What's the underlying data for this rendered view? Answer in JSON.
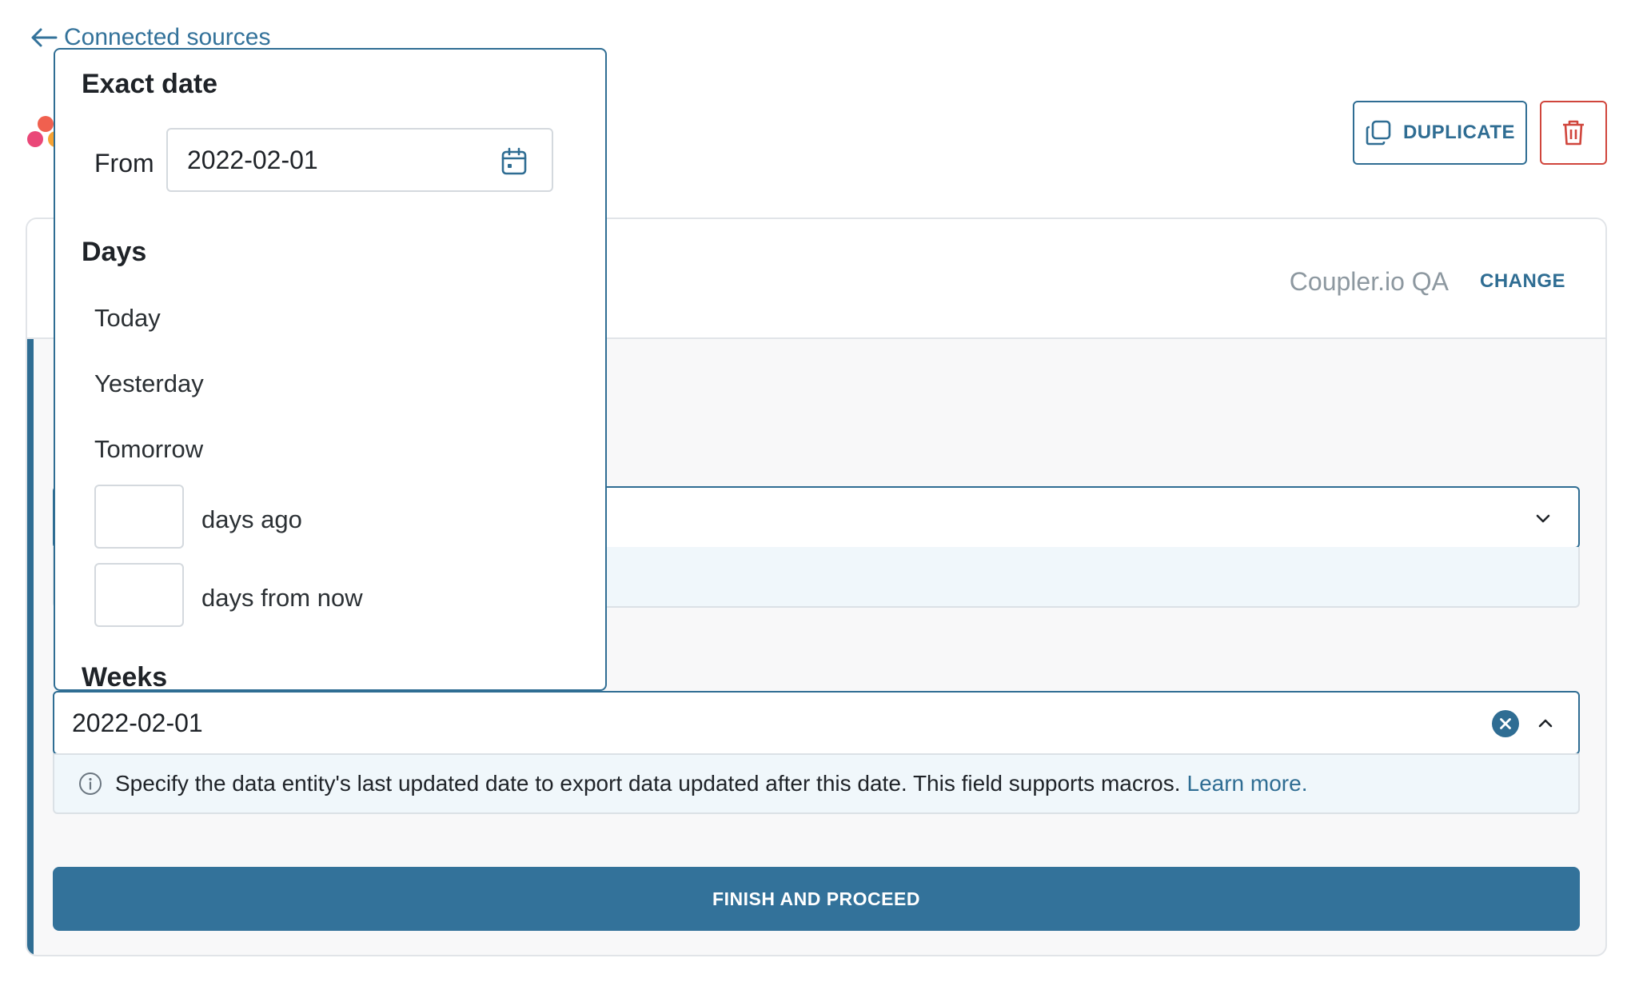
{
  "header": {
    "back_link": "Connected sources",
    "duplicate_label": "DUPLICATE"
  },
  "card": {
    "account_name": "Coupler.io QA",
    "change_label": "CHANGE"
  },
  "date_field": {
    "value": "2022-02-01",
    "hint_text": "Specify the data entity's last updated date to export data updated after this date. This field supports macros.",
    "learn_more": "Learn more."
  },
  "finish_button": "FINISH AND PROCEED",
  "popover": {
    "exact_date_heading": "Exact date",
    "from_label": "From",
    "from_value": "2022-02-01",
    "days_heading": "Days",
    "options": [
      "Today",
      "Yesterday",
      "Tomorrow"
    ],
    "days_ago_label": "days ago",
    "days_from_now_label": "days from now",
    "weeks_heading": "Weeks"
  },
  "colors": {
    "accent": "#2f6d93",
    "primary_button": "#33729a",
    "danger": "#d0453c",
    "hint_background": "#f0f7fb"
  },
  "icons": [
    "arrow-left-icon",
    "logo-icon",
    "duplicate-icon",
    "trash-icon",
    "chevron-down-icon",
    "clear-icon",
    "chevron-up-icon",
    "info-icon",
    "calendar-icon"
  ]
}
